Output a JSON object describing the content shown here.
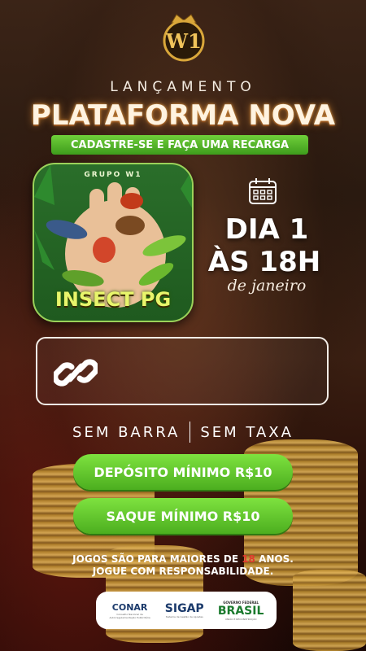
{
  "header": {
    "logo_text": "W1",
    "subtitle": "LANÇAMENTO",
    "title": "PLATAFORMA NOVA",
    "cta_banner": "CADASTRE-SE E FAÇA UMA RECARGA"
  },
  "game": {
    "group_label": "GRUPO W1",
    "name": "INSECT PG"
  },
  "launch_date": {
    "icon": "calendar-icon",
    "day": "DIA 1",
    "time": "ÀS 18H",
    "month": "de janeiro"
  },
  "link_box": {
    "icon": "link-icon"
  },
  "tagline": {
    "left": "SEM BARRA",
    "right": "SEM TAXA"
  },
  "buttons": {
    "deposit": "DEPÓSITO MÍNIMO R$10",
    "withdraw": "SAQUE MÍNIMO R$10"
  },
  "disclaimer": {
    "line1_prefix": "JOGOS SÃO PARA MAIORES DE ",
    "line1_age": "18",
    "line1_suffix": " ANOS.",
    "line2": "JOGUE COM RESPONSABILIDADE."
  },
  "partners": {
    "conar": {
      "name": "CONAR",
      "sub": "Conselho Nacional de Autorregulamentação Publicitária"
    },
    "sigap": {
      "name": "SIGAP",
      "sub": "Sistema de Gestão de Apostas"
    },
    "gov": {
      "top": "GOVERNO FEDERAL",
      "name": "BRASIL",
      "sub": "UNIÃO E RECONSTRUÇÃO"
    }
  },
  "colors": {
    "accent_green": "#4cae1f",
    "title_glow": "#e6a24c",
    "warning_red": "#e2392e",
    "gold": "#c79a3a"
  }
}
